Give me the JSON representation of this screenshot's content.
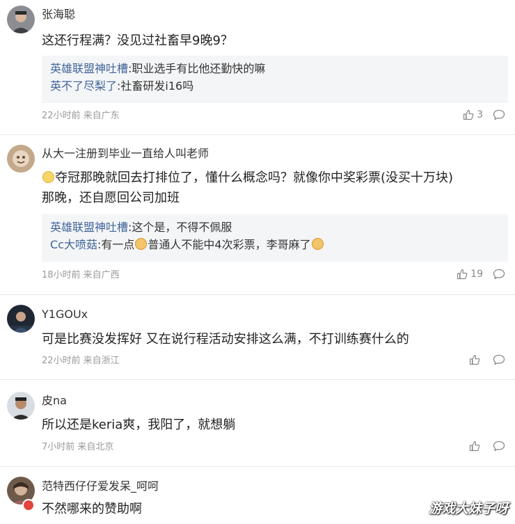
{
  "comments": [
    {
      "username": "张海聪",
      "text": "这还行程满？没见过社畜早9晚9？",
      "replies": [
        {
          "author": "英雄联盟神吐槽",
          "text": ":职业选手有比他还勤快的嘛"
        },
        {
          "author": "英不了尽梨了",
          "text": ":社畜研发i16吗"
        }
      ],
      "meta": "22小时前 来自广东",
      "likes": "3"
    },
    {
      "username": "从大一注册到毕业一直给人叫老师",
      "text_line1": "夺冠那晚就回去打排位了，懂什么概念吗？就像你中奖彩票(没买十万块)",
      "text_line2": "那晚，还自愿回公司加班",
      "replies": [
        {
          "author": "英雄联盟神吐槽",
          "text": ":这个是，不得不佩服"
        },
        {
          "author": "Cc大喷菇",
          "text_a": ":有一点",
          "text_b": "普通人不能中4次彩票，李哥麻了"
        }
      ],
      "meta": "18小时前 来自广西",
      "likes": "19"
    },
    {
      "username": "Y1GOUx",
      "text": "可是比赛没发挥好 又在说行程活动安排这么满，不打训练赛什么的",
      "meta": "22小时前 来自浙江"
    },
    {
      "username": "皮na",
      "text": "所以还是keria爽，我阳了，就想躺",
      "meta": "7小时前 来自北京"
    },
    {
      "username": "范特西仔仔爱发呆_呵呵",
      "text": "不然哪来的赞助啊"
    }
  ],
  "watermark": "游戏大妹子呀",
  "colors": {
    "reply_author": "#406599",
    "meta": "#999999",
    "reply_bg": "#f4f5f7"
  }
}
